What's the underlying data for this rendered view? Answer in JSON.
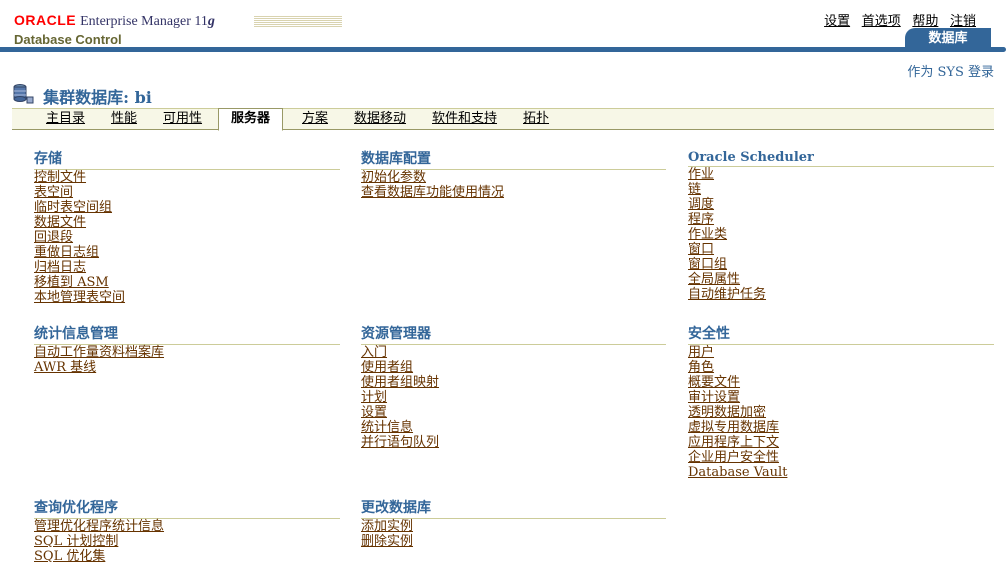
{
  "header": {
    "oracle": "ORACLE",
    "product": "Enterprise Manager 11",
    "version": "g",
    "subtitle": "Database Control",
    "global_links": [
      "设置",
      "首选项",
      "帮助",
      "注销"
    ],
    "db_tab": "数据库"
  },
  "login_as": "作为 SYS 登录",
  "page_title": "集群数据库: bi",
  "tabs": [
    "主目录",
    "性能",
    "可用性",
    "服务器",
    "方案",
    "数据移动",
    "软件和支持",
    "拓扑"
  ],
  "active_tab": "服务器",
  "sections": {
    "storage": {
      "title": "存储",
      "links": [
        "控制文件",
        "表空间",
        "临时表空间组",
        "数据文件",
        "回退段",
        "重做日志组",
        "归档日志",
        "移植到 ASM",
        "本地管理表空间"
      ]
    },
    "db_config": {
      "title": "数据库配置",
      "links": [
        "初始化参数",
        "查看数据库功能使用情况"
      ]
    },
    "scheduler": {
      "title": "Oracle Scheduler",
      "links": [
        "作业",
        "链",
        "调度",
        "程序",
        "作业类",
        "窗口",
        "窗口组",
        "全局属性",
        "自动维护任务"
      ]
    },
    "stats": {
      "title": "统计信息管理",
      "links": [
        "自动工作量资料档案库",
        "AWR 基线"
      ]
    },
    "resource": {
      "title": "资源管理器",
      "links": [
        "入门",
        "使用者组",
        "使用者组映射",
        "计划",
        "设置",
        "统计信息",
        "并行语句队列"
      ]
    },
    "security": {
      "title": "安全性",
      "links": [
        "用户",
        "角色",
        "概要文件",
        "审计设置",
        "透明数据加密",
        "虚拟专用数据库",
        "应用程序上下文",
        "企业用户安全性",
        "Database Vault"
      ]
    },
    "query_opt": {
      "title": "查询优化程序",
      "links": [
        "管理优化程序统计信息",
        "SQL 计划控制",
        "SQL 优化集"
      ]
    },
    "change_db": {
      "title": "更改数据库",
      "links": [
        "添加实例",
        "删除实例"
      ]
    }
  }
}
